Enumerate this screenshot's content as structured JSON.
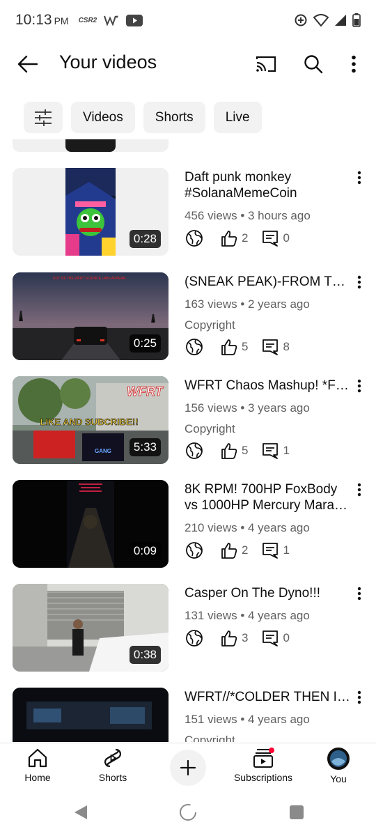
{
  "status_bar": {
    "time": "10:13",
    "ampm": "PM",
    "badge": "CSR2"
  },
  "header": {
    "title": "Your videos"
  },
  "chips": [
    "Videos",
    "Shorts",
    "Live"
  ],
  "videos": [
    {
      "title": "Daft punk monkey #SolanaMemeCoin",
      "meta": "456 views • 3 hours ago",
      "copyright": "",
      "likes": "2",
      "comments": "0",
      "duration": "0:28"
    },
    {
      "title": "(SNEAK PEAK)-FROM TH…",
      "meta": "163 views • 2 years ago",
      "copyright": "Copyright",
      "likes": "5",
      "comments": "8",
      "duration": "0:25",
      "thumb_text": "OUT OF THE WFRT SCIENCE LAB I APPEAR..."
    },
    {
      "title": "WFRT Chaos Mashup! *FT…",
      "meta": "156 views • 3 years ago",
      "copyright": "Copyright",
      "likes": "5",
      "comments": "1",
      "duration": "5:33",
      "thumb_text": "LIKE AND SUBCRIBE!!",
      "thumb_logo": "WFRT",
      "thumb_tag": "GANG"
    },
    {
      "title": "8K RPM! 700HP FoxBody vs 1000HP Mercury Mara…",
      "meta": "210 views • 4 years ago",
      "copyright": "",
      "likes": "2",
      "comments": "1",
      "duration": "0:09"
    },
    {
      "title": "Casper On The Dyno!!!",
      "meta": "131 views • 4 years ago",
      "copyright": "",
      "likes": "3",
      "comments": "0",
      "duration": "0:38"
    },
    {
      "title": "WFRT//*COLDER THEN ICE",
      "meta": "151 views • 4 years ago",
      "copyright": "Copyright"
    }
  ],
  "bottom_nav": {
    "home": "Home",
    "shorts": "Shorts",
    "subscriptions": "Subscriptions",
    "you": "You"
  },
  "colors": {
    "text_primary": "#0f0f0f",
    "text_secondary": "#606060",
    "chip_bg": "#f2f2f2",
    "notification_dot": "#ff0033"
  }
}
